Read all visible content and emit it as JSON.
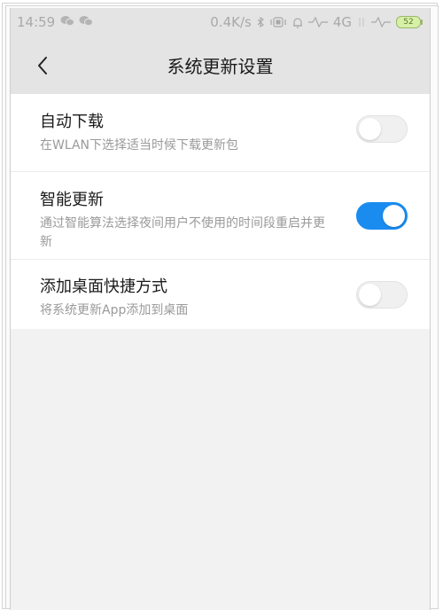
{
  "status_bar": {
    "time": "14:59",
    "network_speed": "0.4K/s",
    "network_type": "4G",
    "battery": "52",
    "icons": [
      "wechat-icon",
      "wechat-icon",
      "bluetooth-icon",
      "vibrate-icon",
      "alarm-icon",
      "signal-icon",
      "signal-icon"
    ]
  },
  "header": {
    "title": "系统更新设置",
    "back_icon": "chevron-left-icon"
  },
  "settings": {
    "auto_download": {
      "title": "自动下载",
      "description": "在WLAN下选择适当时候下载更新包",
      "enabled": false
    },
    "smart_update": {
      "title": "智能更新",
      "description": "通过智能算法选择夜间用户不使用的时间段重启并更新",
      "enabled": true
    },
    "desktop_shortcut": {
      "title": "添加桌面快捷方式",
      "description": "将系统更新App添加到桌面",
      "enabled": false
    }
  },
  "colors": {
    "toggle_on": "#1a8cf0",
    "toggle_off": "#f0f0f0",
    "header_bg": "#e4e4e4",
    "battery_fill": "#d7f0a8"
  }
}
